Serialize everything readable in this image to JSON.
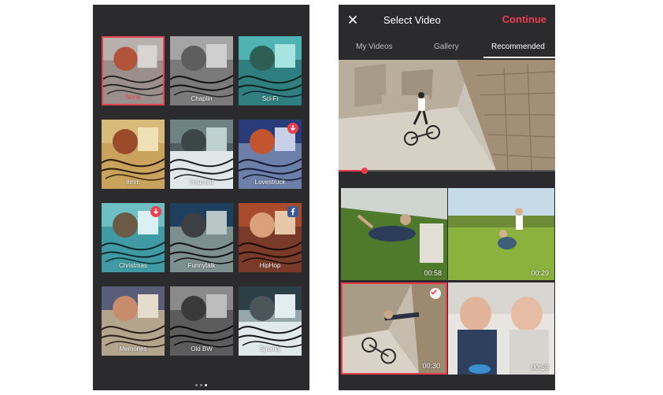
{
  "colors": {
    "accent": "#ef3d4e",
    "panel_bg": "#2b2b2d",
    "text_primary": "#ffffff",
    "text_muted": "#bdbdc0"
  },
  "filters": {
    "items": [
      {
        "label": "None",
        "selected": true,
        "badge": null
      },
      {
        "label": "Chaplin",
        "selected": false,
        "badge": null
      },
      {
        "label": "Sci-Fi",
        "selected": false,
        "badge": null
      },
      {
        "label": "8mm",
        "selected": false,
        "badge": null
      },
      {
        "label": "Haunted",
        "selected": false,
        "badge": null
      },
      {
        "label": "Lovestruck",
        "selected": false,
        "badge": "download-icon"
      },
      {
        "label": "Christmas",
        "selected": false,
        "badge": "download-icon"
      },
      {
        "label": "Funnytalk",
        "selected": false,
        "badge": null
      },
      {
        "label": "HipHop",
        "selected": false,
        "badge": "facebook-icon"
      },
      {
        "label": "Memories",
        "selected": false,
        "badge": null
      },
      {
        "label": "Old BW",
        "selected": false,
        "badge": null
      },
      {
        "label": "Spooky",
        "selected": false,
        "badge": null
      }
    ],
    "pager": {
      "pages": 3,
      "active": 2
    }
  },
  "select_video": {
    "close_icon": "close-icon",
    "title": "Select Video",
    "continue_label": "Continue",
    "tabs": [
      {
        "label": "My Videos",
        "active": false
      },
      {
        "label": "Gallery",
        "active": false
      },
      {
        "label": "Recommended",
        "active": true
      }
    ],
    "preview": {
      "progress": 0.12
    },
    "videos": [
      {
        "duration": "00:58",
        "selected": false
      },
      {
        "duration": "00:29",
        "selected": false
      },
      {
        "duration": "00:30",
        "selected": true
      },
      {
        "duration": "00:59",
        "selected": false
      }
    ]
  }
}
